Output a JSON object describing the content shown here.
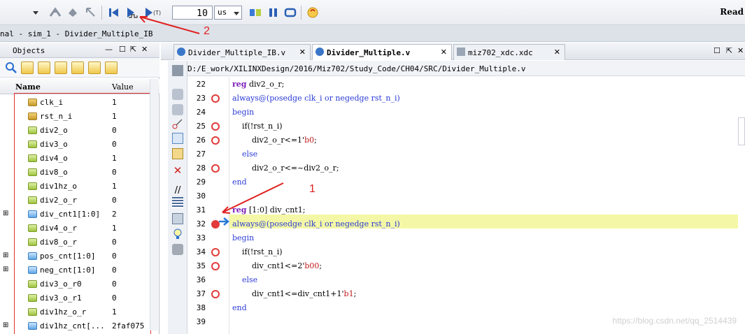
{
  "toolbar": {
    "run_time_value": "10",
    "run_time_unit": "us",
    "status": "Read",
    "icons": [
      "dropdown-icon",
      "relaunch-icon",
      "step-icon",
      "restart-icon",
      "run-all-icon",
      "run-for-icon",
      "run-tick-icon",
      "break-icon",
      "pause-icon",
      "loop-icon",
      "info-icon"
    ]
  },
  "titlebar": {
    "text": "nal - sim_1 - Divider_Multiple_IB"
  },
  "objects": {
    "tab_label": "Objects",
    "col_name": "Name",
    "col_value": "Value",
    "rows": [
      {
        "name": "clk_i",
        "value": "1",
        "kind": "in",
        "expandable": false
      },
      {
        "name": "rst_n_i",
        "value": "1",
        "kind": "in",
        "expandable": false
      },
      {
        "name": "div2_o",
        "value": "0",
        "kind": "out",
        "expandable": false
      },
      {
        "name": "div3_o",
        "value": "0",
        "kind": "out",
        "expandable": false
      },
      {
        "name": "div4_o",
        "value": "1",
        "kind": "out",
        "expandable": false
      },
      {
        "name": "div8_o",
        "value": "0",
        "kind": "out",
        "expandable": false
      },
      {
        "name": "div1hz_o",
        "value": "1",
        "kind": "out",
        "expandable": false
      },
      {
        "name": "div2_o_r",
        "value": "0",
        "kind": "out",
        "expandable": false
      },
      {
        "name": "div_cnt1[1:0]",
        "value": "2",
        "kind": "bus",
        "expandable": true
      },
      {
        "name": "div4_o_r",
        "value": "1",
        "kind": "out",
        "expandable": false
      },
      {
        "name": "div8_o_r",
        "value": "0",
        "kind": "out",
        "expandable": false
      },
      {
        "name": "pos_cnt[1:0]",
        "value": "0",
        "kind": "bus",
        "expandable": true
      },
      {
        "name": "neg_cnt[1:0]",
        "value": "0",
        "kind": "bus",
        "expandable": true
      },
      {
        "name": "div3_o_r0",
        "value": "0",
        "kind": "out",
        "expandable": false
      },
      {
        "name": "div3_o_r1",
        "value": "0",
        "kind": "out",
        "expandable": false
      },
      {
        "name": "div1hz_o_r",
        "value": "1",
        "kind": "out",
        "expandable": false
      },
      {
        "name": "div1hz_cnt[...",
        "value": "2faf075",
        "kind": "bus",
        "expandable": true
      }
    ]
  },
  "editor": {
    "tabs": [
      {
        "label": "Divider_Multiple_IB.v",
        "active": false
      },
      {
        "label": "Divider_Multiple.v",
        "active": true
      },
      {
        "label": "miz702_xdc.xdc",
        "active": false
      }
    ],
    "path": "D:/E_work/XILINXDesign/2016/Miz702/Study_Code/CH04/SRC/Divider_Multiple.v",
    "lines": [
      {
        "n": "22",
        "bp": false,
        "parts": [
          [
            "kw",
            "reg"
          ],
          [
            "",
            "div2_o_r;"
          ]
        ]
      },
      {
        "n": "23",
        "bp": true,
        "parts": [
          [
            "kw2",
            "always@(posedge clk_i or negedge rst_n_i)"
          ]
        ]
      },
      {
        "n": "24",
        "bp": false,
        "parts": [
          [
            "kw2",
            "begin"
          ]
        ]
      },
      {
        "n": "25",
        "bp": true,
        "parts": [
          [
            "",
            "    if(!rst_n_i)"
          ]
        ]
      },
      {
        "n": "26",
        "bp": true,
        "parts": [
          [
            "",
            "        div2_o_r<=1'"
          ],
          [
            "num",
            "b0"
          ],
          [
            "",
            ";"
          ]
        ]
      },
      {
        "n": "27",
        "bp": false,
        "parts": [
          [
            "kw2",
            "    else"
          ]
        ]
      },
      {
        "n": "28",
        "bp": true,
        "parts": [
          [
            "",
            "        div2_o_r<=~div2_o_r;"
          ]
        ]
      },
      {
        "n": "29",
        "bp": false,
        "parts": [
          [
            "kw2",
            "end"
          ]
        ]
      },
      {
        "n": "30",
        "bp": false,
        "parts": [
          [
            "",
            ""
          ]
        ]
      },
      {
        "n": "31",
        "bp": false,
        "parts": [
          [
            "kw",
            "reg"
          ],
          [
            "",
            "[1:0] div_cnt1;"
          ]
        ]
      },
      {
        "n": "32",
        "bp": true,
        "parts": [
          [
            "kw2",
            "always@(posedge clk_i or negedge rst_n_i)"
          ]
        ]
      },
      {
        "n": "33",
        "bp": false,
        "parts": [
          [
            "kw2",
            "begin"
          ]
        ]
      },
      {
        "n": "34",
        "bp": true,
        "parts": [
          [
            "",
            "    if(!rst_n_i)"
          ]
        ]
      },
      {
        "n": "35",
        "bp": true,
        "parts": [
          [
            "",
            "        div_cnt1<=2'"
          ],
          [
            "num",
            "b00"
          ],
          [
            "",
            ";"
          ]
        ]
      },
      {
        "n": "36",
        "bp": false,
        "parts": [
          [
            "kw2",
            "    else"
          ]
        ]
      },
      {
        "n": "37",
        "bp": true,
        "parts": [
          [
            "",
            "        div_cnt1<=div_cnt1+1'"
          ],
          [
            "num",
            "b1"
          ],
          [
            "",
            ";"
          ]
        ]
      },
      {
        "n": "38",
        "bp": false,
        "parts": [
          [
            "kw2",
            "end"
          ]
        ]
      },
      {
        "n": "39",
        "bp": false,
        "parts": [
          [
            "",
            ""
          ]
        ]
      }
    ]
  },
  "annotations": {
    "label_1": "1",
    "label_2": "2"
  },
  "watermark": "https://blog.csdn.net/qq_2514439",
  "colors": {
    "highlight": "#f4f8a6",
    "annotation": "#e02020",
    "breakpoint": "#e23a3a",
    "keyword": "#7a1fb8",
    "keyword2": "#2b3bd6"
  }
}
